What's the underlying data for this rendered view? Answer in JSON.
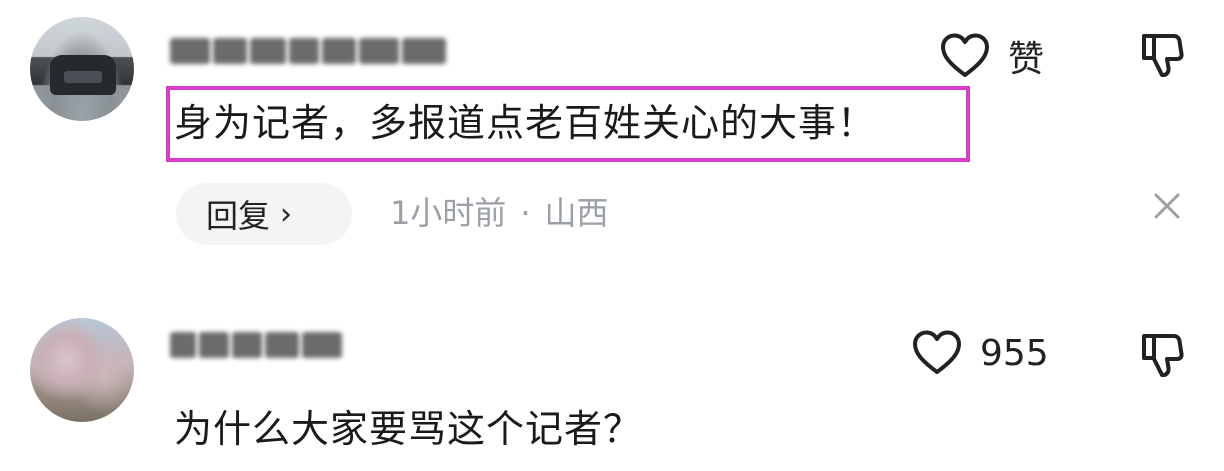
{
  "comments": [
    {
      "avatar": "car-avatar",
      "text": "身为记者，多报道点老百姓关心的大事！",
      "like_label": "赞",
      "reply_label": "回复",
      "time": "1小时前",
      "location": "山西"
    },
    {
      "avatar": "tree-avatar",
      "text": "为什么大家要骂这个记者？",
      "like_label": "955"
    }
  ],
  "icons": {
    "like": "heart-outline-icon",
    "dislike": "thumbs-down-icon",
    "dismiss": "close-icon",
    "reply_chevron": "chevron-right-icon"
  },
  "colors": {
    "highlight_border": "#d43fc7",
    "meta_text": "#9aa0a6",
    "reply_pill_bg": "#f3f4f6"
  }
}
